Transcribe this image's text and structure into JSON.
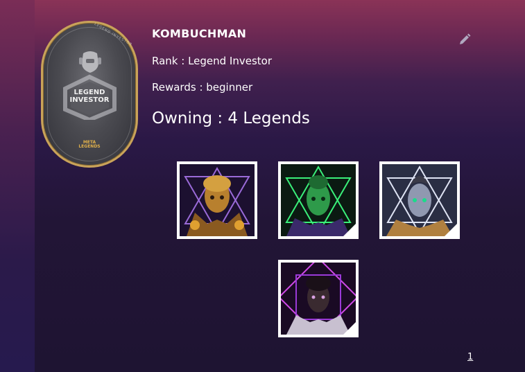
{
  "profile": {
    "name": "KOMBUCHMAN",
    "rank": "Rank : Legend Investor",
    "rewards": "Rewards : beginner",
    "owning": "Owning : 4 Legends"
  },
  "badge": {
    "title_line1": "LEGEND",
    "title_line2": "INVESTOR",
    "brand_line1": "META",
    "brand_line2": "LEGENDS",
    "arc_text": "LEGEND INVESTOR"
  },
  "legends": [
    {
      "icon": "golden-legend-avatar",
      "accent": "#c07a2a"
    },
    {
      "icon": "green-legend-avatar",
      "accent": "#2fd16a"
    },
    {
      "icon": "silver-legend-avatar",
      "accent": "#b9c0d8"
    },
    {
      "icon": "purple-legend-avatar",
      "accent": "#c03ad8"
    }
  ],
  "edit": {
    "icon": "pencil-icon"
  },
  "pagination": {
    "current_page": "1"
  }
}
